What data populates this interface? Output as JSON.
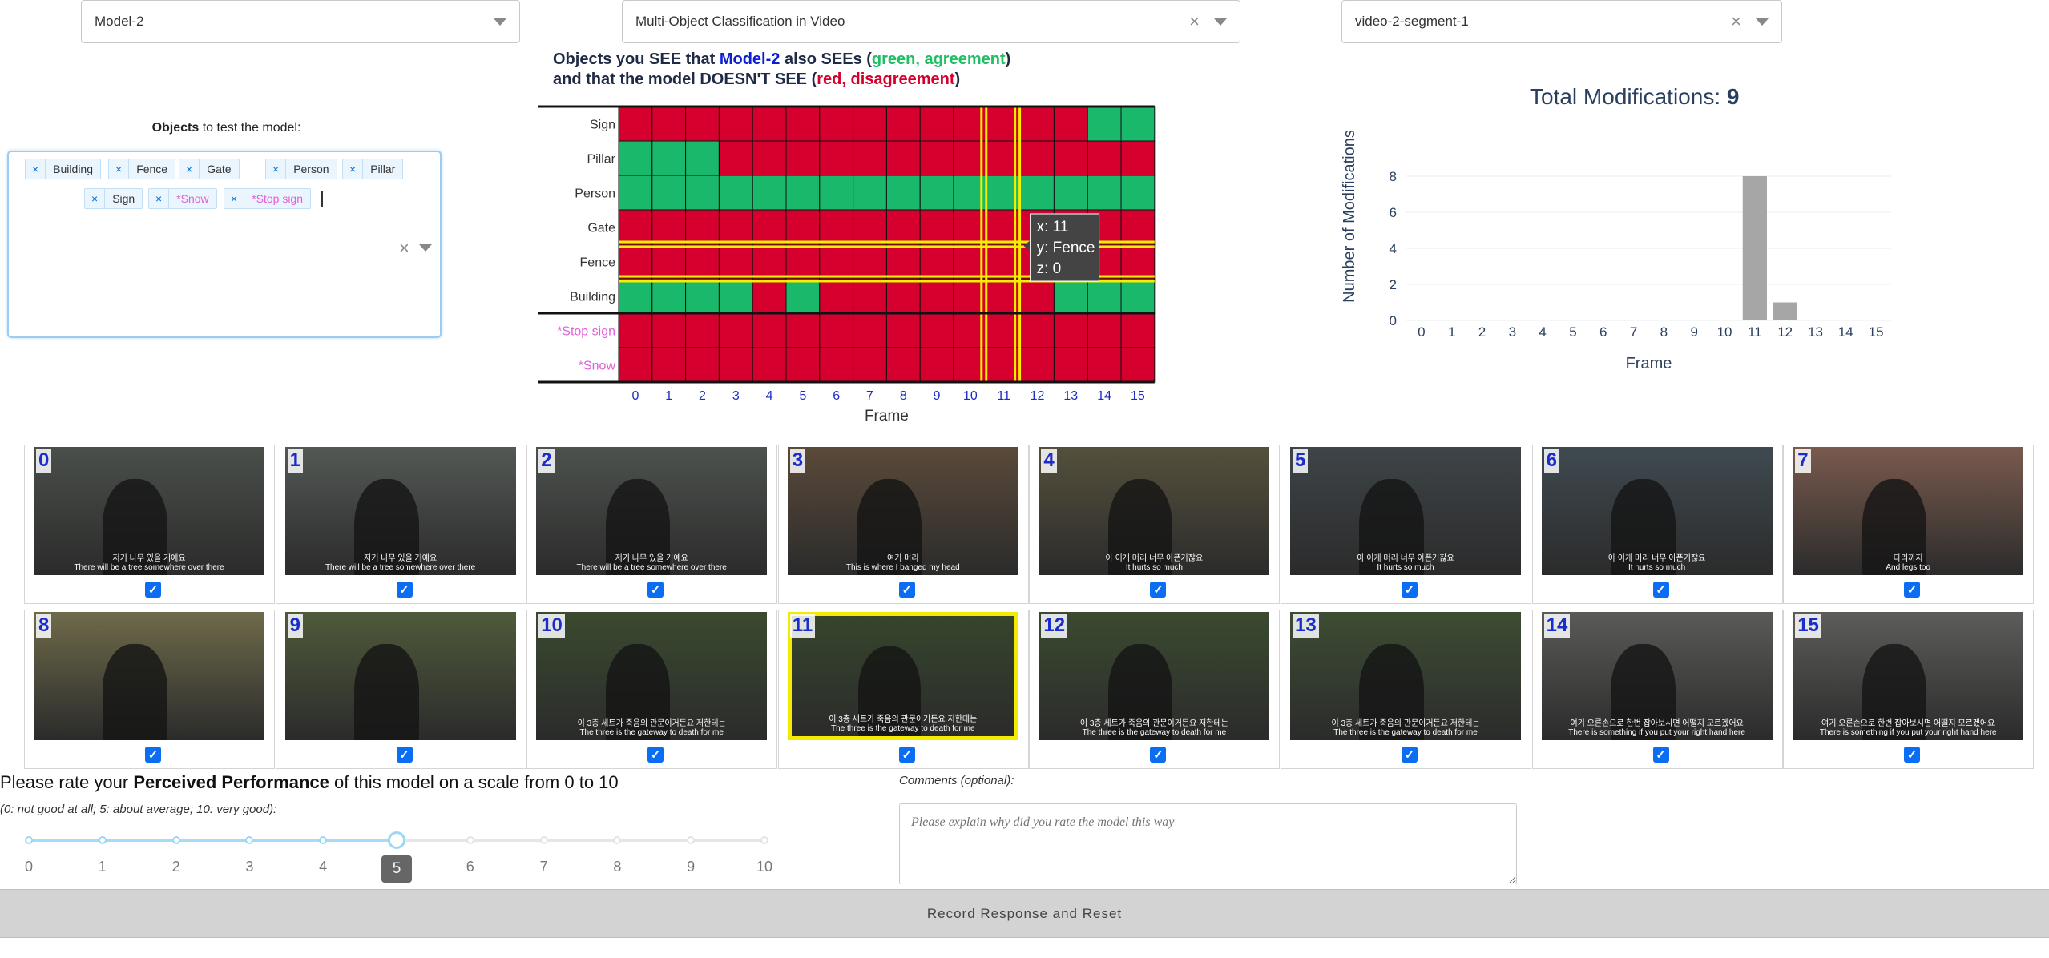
{
  "dropdowns": {
    "model": {
      "value": "Model-2"
    },
    "task": {
      "value": "Multi-Object Classification in Video"
    },
    "segment": {
      "value": "video-2-segment-1"
    }
  },
  "objects_selector": {
    "label_bold": "Objects",
    "label_rest": " to test the model:",
    "chips": [
      {
        "label": "Building",
        "custom": false
      },
      {
        "label": "Fence",
        "custom": false
      },
      {
        "label": "Gate",
        "custom": false
      },
      {
        "label": "Person",
        "custom": false
      },
      {
        "label": "Pillar",
        "custom": false
      },
      {
        "label": "Sign",
        "custom": false
      },
      {
        "label": "*Snow",
        "custom": true
      },
      {
        "label": "*Stop sign",
        "custom": true
      }
    ]
  },
  "heatmap": {
    "title_line1_a": "Objects you SEE that ",
    "title_line1_model": "Model-2",
    "title_line1_b": " also SEEs (",
    "title_line1_green": "green, agreement",
    "title_line1_c": ")",
    "title_line2_a": " and that the model DOESN'T SEE (",
    "title_line2_red": "red, disagreement",
    "title_line2_b": ")",
    "xlabel": "Frame",
    "tooltip": {
      "x": "x: 11",
      "y": "y: Fence",
      "z": "z: 0"
    },
    "colors": {
      "agree": "#19b86b",
      "disagree": "#d6002f",
      "highlight": "#f5ee00",
      "custom_label": "#e060d8"
    }
  },
  "chart_data": [
    {
      "type": "heatmap",
      "x": [
        0,
        1,
        2,
        3,
        4,
        5,
        6,
        7,
        8,
        9,
        10,
        11,
        12,
        13,
        14,
        15
      ],
      "y": [
        "Sign",
        "Pillar",
        "Person",
        "Gate",
        "Fence",
        "Building",
        "*Stop sign",
        "*Snow"
      ],
      "z": [
        [
          0,
          0,
          0,
          0,
          0,
          0,
          0,
          0,
          0,
          0,
          0,
          0,
          0,
          0,
          1,
          1
        ],
        [
          1,
          1,
          1,
          0,
          0,
          0,
          0,
          0,
          0,
          0,
          0,
          0,
          0,
          0,
          0,
          0
        ],
        [
          1,
          1,
          1,
          1,
          1,
          1,
          1,
          1,
          1,
          1,
          1,
          1,
          1,
          1,
          1,
          1
        ],
        [
          0,
          0,
          0,
          0,
          0,
          0,
          0,
          0,
          0,
          0,
          0,
          0,
          0,
          0,
          0,
          0
        ],
        [
          0,
          0,
          0,
          0,
          0,
          0,
          0,
          0,
          0,
          0,
          0,
          0,
          0,
          0,
          0,
          0
        ],
        [
          1,
          1,
          1,
          1,
          0,
          1,
          0,
          0,
          0,
          0,
          0,
          0,
          0,
          1,
          1,
          1
        ],
        [
          0,
          0,
          0,
          0,
          0,
          0,
          0,
          0,
          0,
          0,
          0,
          0,
          0,
          0,
          0,
          0
        ],
        [
          0,
          0,
          0,
          0,
          0,
          0,
          0,
          0,
          0,
          0,
          0,
          0,
          0,
          0,
          0,
          0
        ]
      ],
      "highlight_x": [
        10,
        11
      ],
      "highlight_y": [
        "Gate",
        "Fence"
      ],
      "xlabel": "Frame"
    },
    {
      "type": "bar",
      "title": "Total Modifications: ",
      "title_value": "9",
      "categories": [
        0,
        1,
        2,
        3,
        4,
        5,
        6,
        7,
        8,
        9,
        10,
        11,
        12,
        13,
        14,
        15
      ],
      "values": [
        0,
        0,
        0,
        0,
        0,
        0,
        0,
        0,
        0,
        0,
        0,
        8,
        1,
        0,
        0,
        0
      ],
      "xlabel": "Frame",
      "ylabel": "Number of Modifications",
      "yticks": [
        0,
        2,
        4,
        6,
        8
      ],
      "ylim": [
        0,
        9
      ],
      "bar_color": "#a6a6a6"
    }
  ],
  "frames": [
    {
      "num": "0",
      "caption1": "저기 나무 있을 거예요",
      "caption2": "There will be a tree somewhere over there",
      "checked": true,
      "scene": "#4a4f4a"
    },
    {
      "num": "1",
      "caption1": "저기 나무 있을 거예요",
      "caption2": "There will be a tree somewhere over there",
      "checked": true,
      "scene": "#535855"
    },
    {
      "num": "2",
      "caption1": "저기 나무 있을 거예요",
      "caption2": "There will be a tree somewhere over there",
      "checked": true,
      "scene": "#4d524e"
    },
    {
      "num": "3",
      "caption1": "여기 머리",
      "caption2": "This is where I banged my head",
      "checked": true,
      "scene": "#5a4a3a"
    },
    {
      "num": "4",
      "caption1": "아 이게 머리 너무 아픈거잖요",
      "caption2": "It hurts so much",
      "checked": true,
      "scene": "#55503c"
    },
    {
      "num": "5",
      "caption1": "아 이게 머리 너무 아픈거잖요",
      "caption2": "It hurts so much",
      "checked": true,
      "scene": "#3e4448"
    },
    {
      "num": "6",
      "caption1": "아 이게 머리 너무 아픈거잖요",
      "caption2": "It hurts so much",
      "checked": true,
      "scene": "#3f4a50"
    },
    {
      "num": "7",
      "caption1": "다리까지",
      "caption2": "And legs too",
      "checked": true,
      "scene": "#7a5a4e"
    },
    {
      "num": "8",
      "caption1": "",
      "caption2": "",
      "checked": true,
      "scene": "#6e6a4a"
    },
    {
      "num": "9",
      "caption1": "",
      "caption2": "",
      "checked": true,
      "scene": "#4f5a3a"
    },
    {
      "num": "10",
      "caption1": "이 3층 세트가 죽음의 관문이거든요 저한테는",
      "caption2": "The three is the gateway to death for me",
      "checked": true,
      "scene": "#3a4a2f"
    },
    {
      "num": "11",
      "caption1": "이 3층 세트가 죽음의 관문이거든요 저한테는",
      "caption2": "The three is the gateway to death for me",
      "checked": true,
      "scene": "#36452c",
      "selected": true
    },
    {
      "num": "12",
      "caption1": "이 3층 세트가 죽음의 관문이거든요 저한테는",
      "caption2": "The three is the gateway to death for me",
      "checked": true,
      "scene": "#3b4a30"
    },
    {
      "num": "13",
      "caption1": "이 3층 세트가 죽음의 관문이거든요 저한테는",
      "caption2": "The three is the gateway to death for me",
      "checked": true,
      "scene": "#3d4d33"
    },
    {
      "num": "14",
      "caption1": "여기 오른손으로 한번 잡아보시면 어떨지 모르겠어요",
      "caption2": "There is something if you put your right hand here",
      "checked": true,
      "scene": "#5a5b58"
    },
    {
      "num": "15",
      "caption1": "여기 오른손으로 한번 잡아보시면 어떨지 모르겠어요",
      "caption2": "There is something if you put your right hand here",
      "checked": true,
      "scene": "#5c5d5a"
    }
  ],
  "rating": {
    "title_a": "Please rate your ",
    "title_bold": "Perceived Performance",
    "title_b": " of this model on a scale from 0 to 10",
    "help": "(0: not good at all; 5: about average; 10: very good):",
    "ticks": [
      "0",
      "1",
      "2",
      "3",
      "4",
      "5",
      "6",
      "7",
      "8",
      "9",
      "10"
    ],
    "value": 5,
    "value_label": "5",
    "track_active": "#a3dcf6",
    "track_inactive": "#e6e6e6"
  },
  "comments": {
    "label": "Comments (optional):",
    "placeholder": "Please explain why did you rate the model this way"
  },
  "record_button": {
    "label": "Record Response and Reset"
  }
}
